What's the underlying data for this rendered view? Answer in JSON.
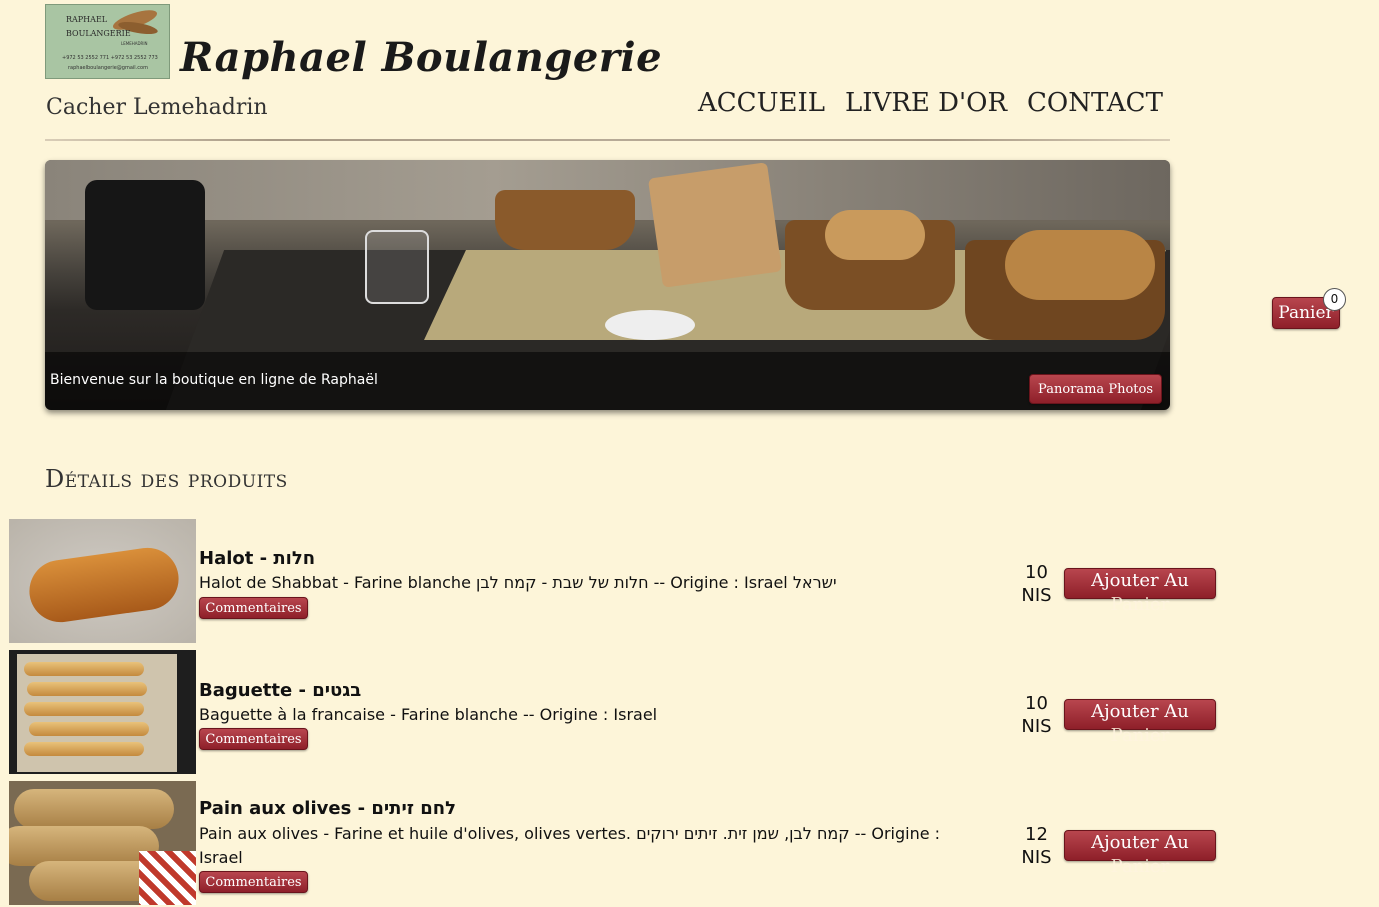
{
  "header": {
    "logo": {
      "line1": "RAPHAEL",
      "line2": "BOULANGERIE",
      "line3": "LEMEHADRIN",
      "phones": "+972 53 2552 771   +972 53 2552 773",
      "email": "raphaelboulangerie@gmail.com"
    },
    "site_title": "Raphael Boulangerie",
    "tagline": "Cacher Lemehadrin",
    "nav": [
      "ACCUEIL",
      "LIVRE D'OR",
      "CONTACT"
    ]
  },
  "hero": {
    "caption": "Bienvenue sur la boutique en ligne de Raphaël",
    "panorama_button": "Panorama Photos"
  },
  "cart": {
    "label": "Panier",
    "count": "0"
  },
  "section_title": "Détails des produits",
  "products": [
    {
      "name": "Halot - חלות",
      "description": "Halot de Shabbat - Farine blanche חלות של שבת - קמח לבן -- Origine : Israel ישראל",
      "comments_button": "Commentaires",
      "price_value": "10",
      "price_currency": "NIS",
      "add_line1": "Ajouter Au",
      "add_line2": "Panier"
    },
    {
      "name": "Baguette - בגטים",
      "description": "Baguette à la francaise - Farine blanche -- Origine : Israel",
      "comments_button": "Commentaires",
      "price_value": "10",
      "price_currency": "NIS",
      "add_line1": "Ajouter Au",
      "add_line2": "Panier"
    },
    {
      "name": "Pain aux olives - לחם זיתים",
      "description": "Pain aux olives - Farine et huile d'olives, olives vertes. קמח לבן, שמן זית. זיתים ירוקים -- Origine : Israel",
      "comments_button": "Commentaires",
      "price_value": "12",
      "price_currency": "NIS",
      "add_line1": "Ajouter Au",
      "add_line2": "Panier"
    }
  ],
  "colors": {
    "page_background": "#fdf5d9",
    "button_red": "#8e1f29"
  }
}
